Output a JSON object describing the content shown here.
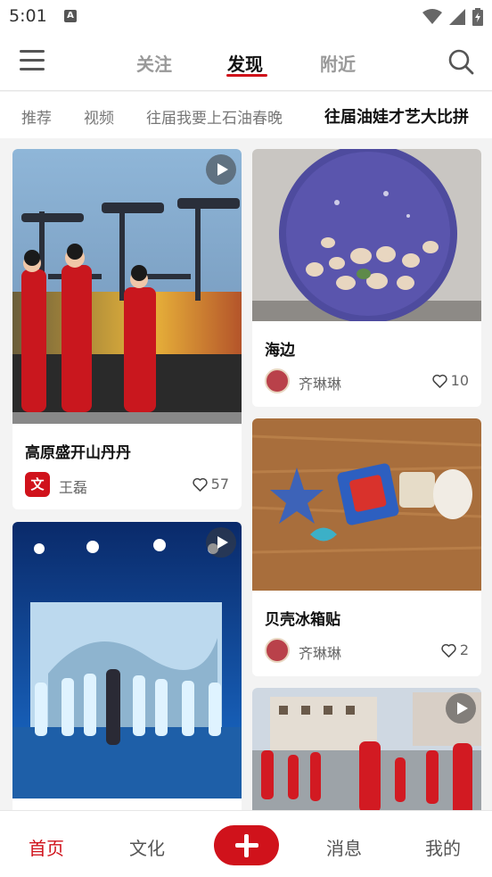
{
  "status_bar": {
    "time": "5:01",
    "a_label": "A"
  },
  "top_nav": {
    "tabs": [
      {
        "label": "关注",
        "active": false
      },
      {
        "label": "发现",
        "active": true
      },
      {
        "label": "附近",
        "active": false
      }
    ]
  },
  "sub_tabs": [
    {
      "label": "推荐",
      "active": false
    },
    {
      "label": "视频",
      "active": false
    },
    {
      "label": "往届我要上石油春晚",
      "active": false
    },
    {
      "label": "往届油娃才艺大比拼",
      "active": true
    }
  ],
  "feed": {
    "cards": [
      {
        "title": "高原盛开山丹丹",
        "author": "王磊",
        "avatar_label": "文",
        "likes": "57",
        "has_video": true
      },
      {
        "title": "海边",
        "author": "齐琳琳",
        "avatar_label": "",
        "likes": "10",
        "has_video": false
      },
      {
        "title": "贝壳冰箱贴",
        "author": "齐琳琳",
        "avatar_label": "",
        "likes": "2",
        "has_video": false
      },
      {
        "title": "",
        "author": "",
        "avatar_label": "",
        "likes": "",
        "has_video": true
      },
      {
        "title": "",
        "author": "",
        "avatar_label": "",
        "likes": "",
        "has_video": true
      }
    ]
  },
  "bottom_nav": {
    "items": [
      {
        "label": "首页",
        "active": true
      },
      {
        "label": "文化",
        "active": false
      },
      {
        "label": "消息",
        "active": false
      },
      {
        "label": "我的",
        "active": false
      }
    ]
  },
  "colors": {
    "accent": "#d0121b",
    "background": "#f3f3f3"
  }
}
